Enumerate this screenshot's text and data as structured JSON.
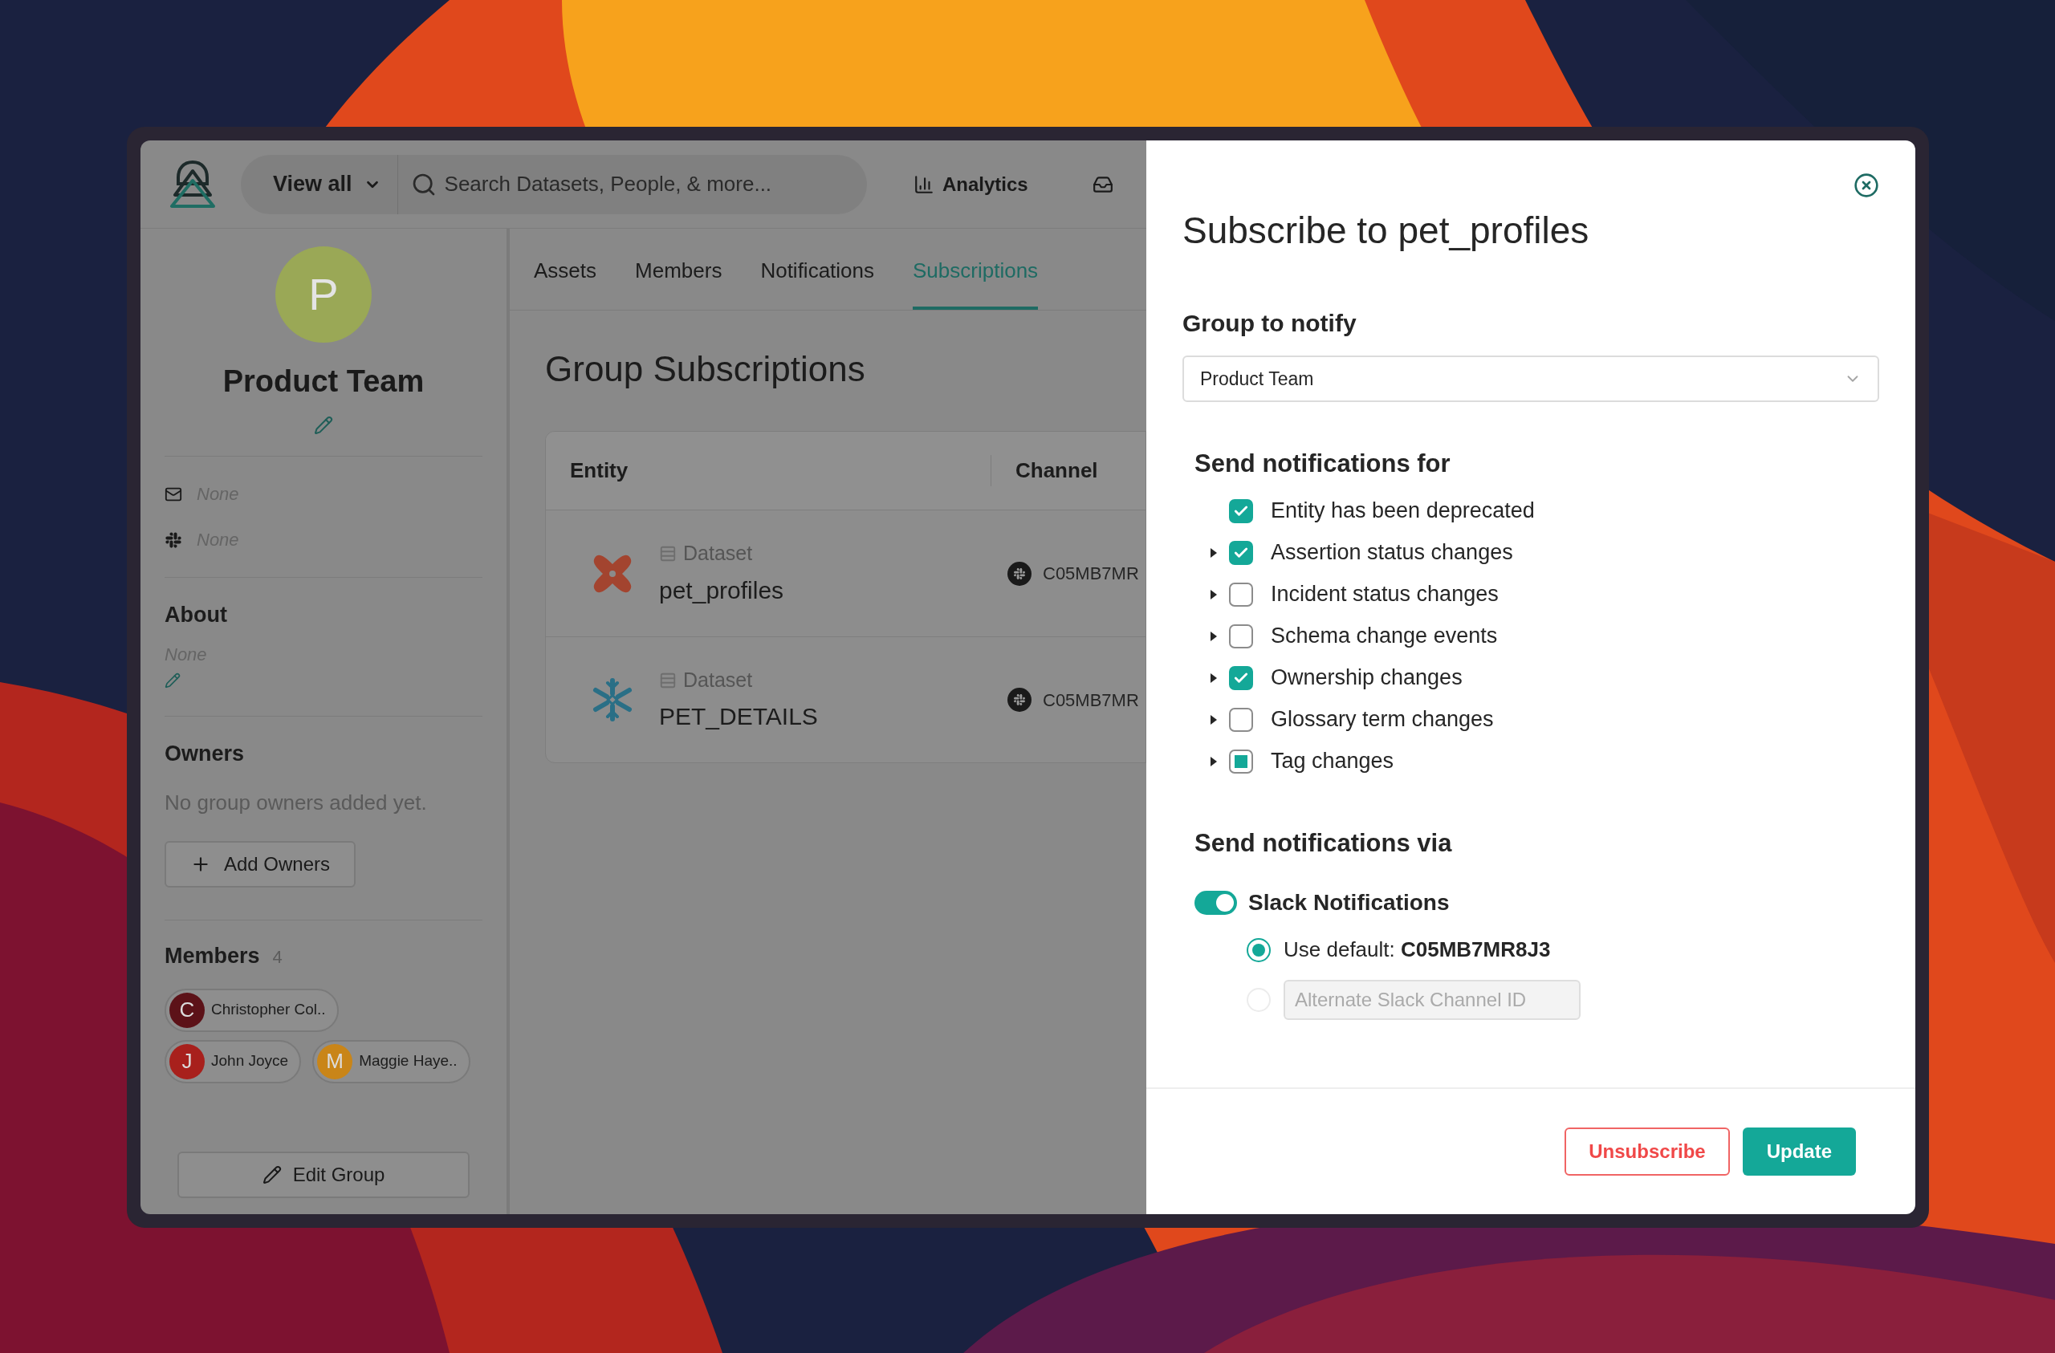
{
  "header": {
    "scope_button": "View all",
    "search": {
      "placeholder": "Search Datasets, People, & more..."
    },
    "nav": [
      {
        "label": "Analytics"
      }
    ]
  },
  "sidebar": {
    "avatar_letter": "P",
    "group_name": "Product Team",
    "contacts": [
      {
        "kind": "email",
        "value": "None"
      },
      {
        "kind": "slack",
        "value": "None"
      }
    ],
    "about": {
      "title": "About",
      "value": "None"
    },
    "owners": {
      "title": "Owners",
      "empty_text": "No group owners added yet.",
      "add_button": "Add Owners"
    },
    "members": {
      "title": "Members",
      "count": "4",
      "items": [
        {
          "initial": "C",
          "name": "Christopher Col..",
          "color": "#5c1218"
        },
        {
          "initial": "J",
          "name": "John Joyce",
          "color": "#a8201c"
        },
        {
          "initial": "M",
          "name": "Maggie Haye..",
          "color": "#c98518"
        }
      ]
    },
    "edit_button": "Edit Group"
  },
  "tabs": [
    {
      "label": "Assets",
      "selected": false
    },
    {
      "label": "Members",
      "selected": false
    },
    {
      "label": "Notifications",
      "selected": false
    },
    {
      "label": "Subscriptions",
      "selected": true
    }
  ],
  "page_title": "Group Subscriptions",
  "table": {
    "columns": [
      "Entity",
      "Channel"
    ],
    "rows": [
      {
        "kind": "dbt",
        "type": "Dataset",
        "name": "pet_profiles",
        "channel": "C05MB7MR"
      },
      {
        "kind": "snowflake",
        "type": "Dataset",
        "name": "PET_DETAILS",
        "channel": "C05MB7MR"
      }
    ]
  },
  "modal": {
    "title": "Subscribe to pet_profiles",
    "group_label": "Group to notify",
    "group_value": "Product Team",
    "events_title": "Send notifications for",
    "events": [
      {
        "label": "Entity has been deprecated",
        "expandable": false,
        "checked": true,
        "indeterminate": false
      },
      {
        "label": "Assertion status changes",
        "expandable": true,
        "checked": true,
        "indeterminate": false
      },
      {
        "label": "Incident status changes",
        "expandable": true,
        "checked": false,
        "indeterminate": false
      },
      {
        "label": "Schema change events",
        "expandable": true,
        "checked": false,
        "indeterminate": false
      },
      {
        "label": "Ownership changes",
        "expandable": true,
        "checked": true,
        "indeterminate": false
      },
      {
        "label": "Glossary term changes",
        "expandable": true,
        "checked": false,
        "indeterminate": false
      },
      {
        "label": "Tag changes",
        "expandable": true,
        "checked": false,
        "indeterminate": true
      }
    ],
    "via_title": "Send notifications via",
    "slack": {
      "label": "Slack Notifications",
      "on": true,
      "options": [
        {
          "kind": "default",
          "label": "Use default: **C05MB7MR8J3**",
          "selected": true,
          "disabled": false
        },
        {
          "kind": "input",
          "placeholder": "Alternate Slack Channel ID",
          "selected": false,
          "disabled": true
        }
      ]
    },
    "buttons": [
      {
        "kind": "danger",
        "label": "Unsubscribe"
      },
      {
        "kind": "primary",
        "label": "Update"
      }
    ]
  }
}
